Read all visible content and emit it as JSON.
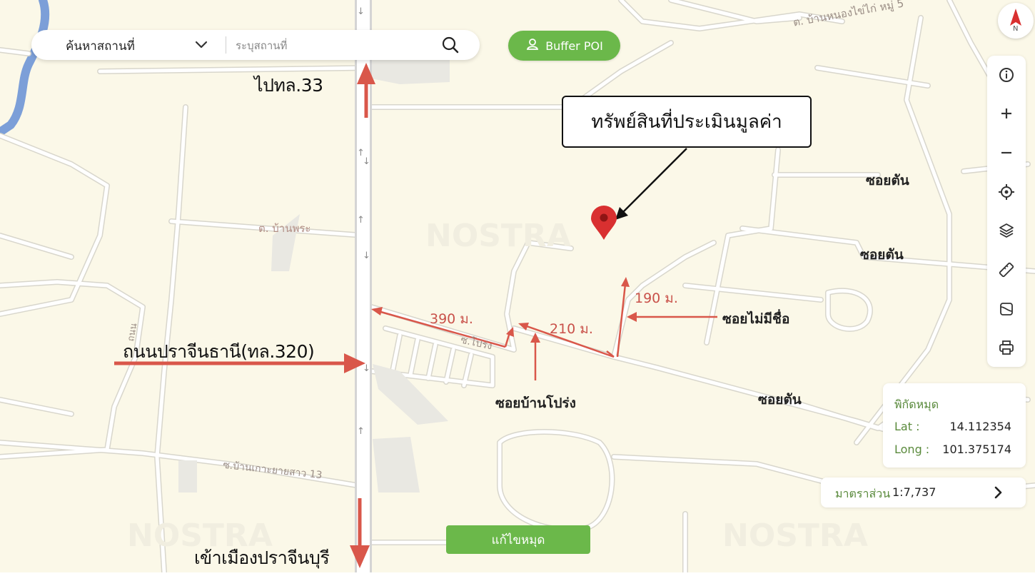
{
  "search": {
    "mode_label": "ค้นหาสถานที่",
    "placeholder": "ระบุสถานที่"
  },
  "buffer_button": {
    "label": "Buffer POI"
  },
  "compass": {
    "letter": "N"
  },
  "toolbar": {
    "items": [
      "info-icon",
      "zoom-in-icon",
      "zoom-out-icon",
      "locate-icon",
      "layers-icon",
      "ruler-icon",
      "map-style-icon",
      "print-icon"
    ]
  },
  "map": {
    "watermark": "NOSTRA",
    "road_labels": {
      "top_road": "ต. บ้านหนองไข่ไก่ หมู่ 5",
      "ban_phra": "ต. บ้านพระ",
      "khao_ko": "ซ.บ้านเกาะยายสาว 13",
      "pong_road": "ซ.โปร่ง",
      "vertical_road": "ถนน"
    }
  },
  "annotations": {
    "property": "ทรัพย์สินที่ประเมินมูลค่า",
    "to_highway_33": "ไปทล.33",
    "main_road": "ถนนปราจีนธานี(ทล.320)",
    "to_city": "เข้าเมืองปราจีนบุรี",
    "soi_ban_prong": "ซอยบ้านโปร่ง",
    "soi_no_name": "ซอยไม่มีชื่อ",
    "dead_end_1": "ซอยตัน",
    "dead_end_2": "ซอยตัน",
    "dead_end_3": "ซอยตัน",
    "dist_390": "390 ม.",
    "dist_210": "210 ม.",
    "dist_190": "190 ม."
  },
  "coordinates": {
    "title": "พิกัดหมุด",
    "lat_label": "Lat :",
    "lat_value": "14.112354",
    "long_label": "Long :",
    "long_value": "101.375174"
  },
  "scale": {
    "label": "มาตราส่วน",
    "value": "1:7,737"
  },
  "edit_pin_button": {
    "label": "แก้ไขหมุด"
  },
  "colors": {
    "map_bg": "#fbf8e8",
    "road": "#ffffff",
    "annotation_red": "#d9574a",
    "button_green": "#6bb84a",
    "pin_red": "#d93030",
    "water": "#7c9fd8"
  }
}
